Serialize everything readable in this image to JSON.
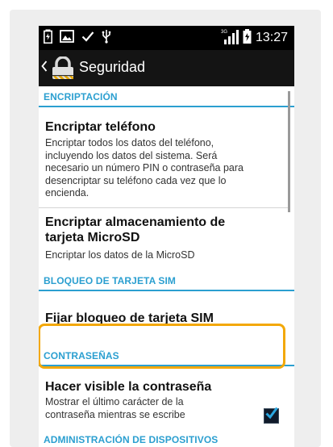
{
  "status_bar": {
    "time": "13:27",
    "icons": [
      "battery-charging-icon",
      "image-icon",
      "check-icon",
      "usb-icon",
      "signal-3g-icon",
      "battery-icon"
    ]
  },
  "action_bar": {
    "back_icon": "chevron-left-icon",
    "app_icon": "lock-icon",
    "title": "Seguridad"
  },
  "sections": {
    "encryption": {
      "header": "ENCRIPTACIÓN",
      "items": [
        {
          "title": "Encriptar teléfono",
          "subtitle_lines": [
            "Encriptar todos los datos del teléfono,",
            "incluyendo los datos del sistema. Será",
            "necesario un número PIN o contraseña para",
            "desencriptar su teléfono cada vez que lo",
            "encienda."
          ]
        },
        {
          "title_lines": [
            "Encriptar almacenamiento de",
            "tarjeta MicroSD"
          ],
          "subtitle": "Encriptar los datos de la MicroSD"
        }
      ]
    },
    "sim_lock": {
      "header": "BLOQUEO DE TARJETA SIM",
      "items": [
        {
          "title": "Fijar bloqueo de tarjeta SIM"
        }
      ]
    },
    "passwords": {
      "header": "CONTRASEÑAS",
      "items": [
        {
          "title": "Hacer visible la contraseña",
          "subtitle_lines": [
            "Mostrar el último carácter de la",
            "contraseña mientras se escribe"
          ],
          "checked": true
        }
      ]
    },
    "device_admin": {
      "header": "ADMINISTRACIÓN DE DISPOSITIVOS"
    }
  },
  "colors": {
    "accent": "#2b9fd0",
    "highlight": "#f3a807",
    "status_bar": "#000000",
    "action_bar": "#141414"
  }
}
